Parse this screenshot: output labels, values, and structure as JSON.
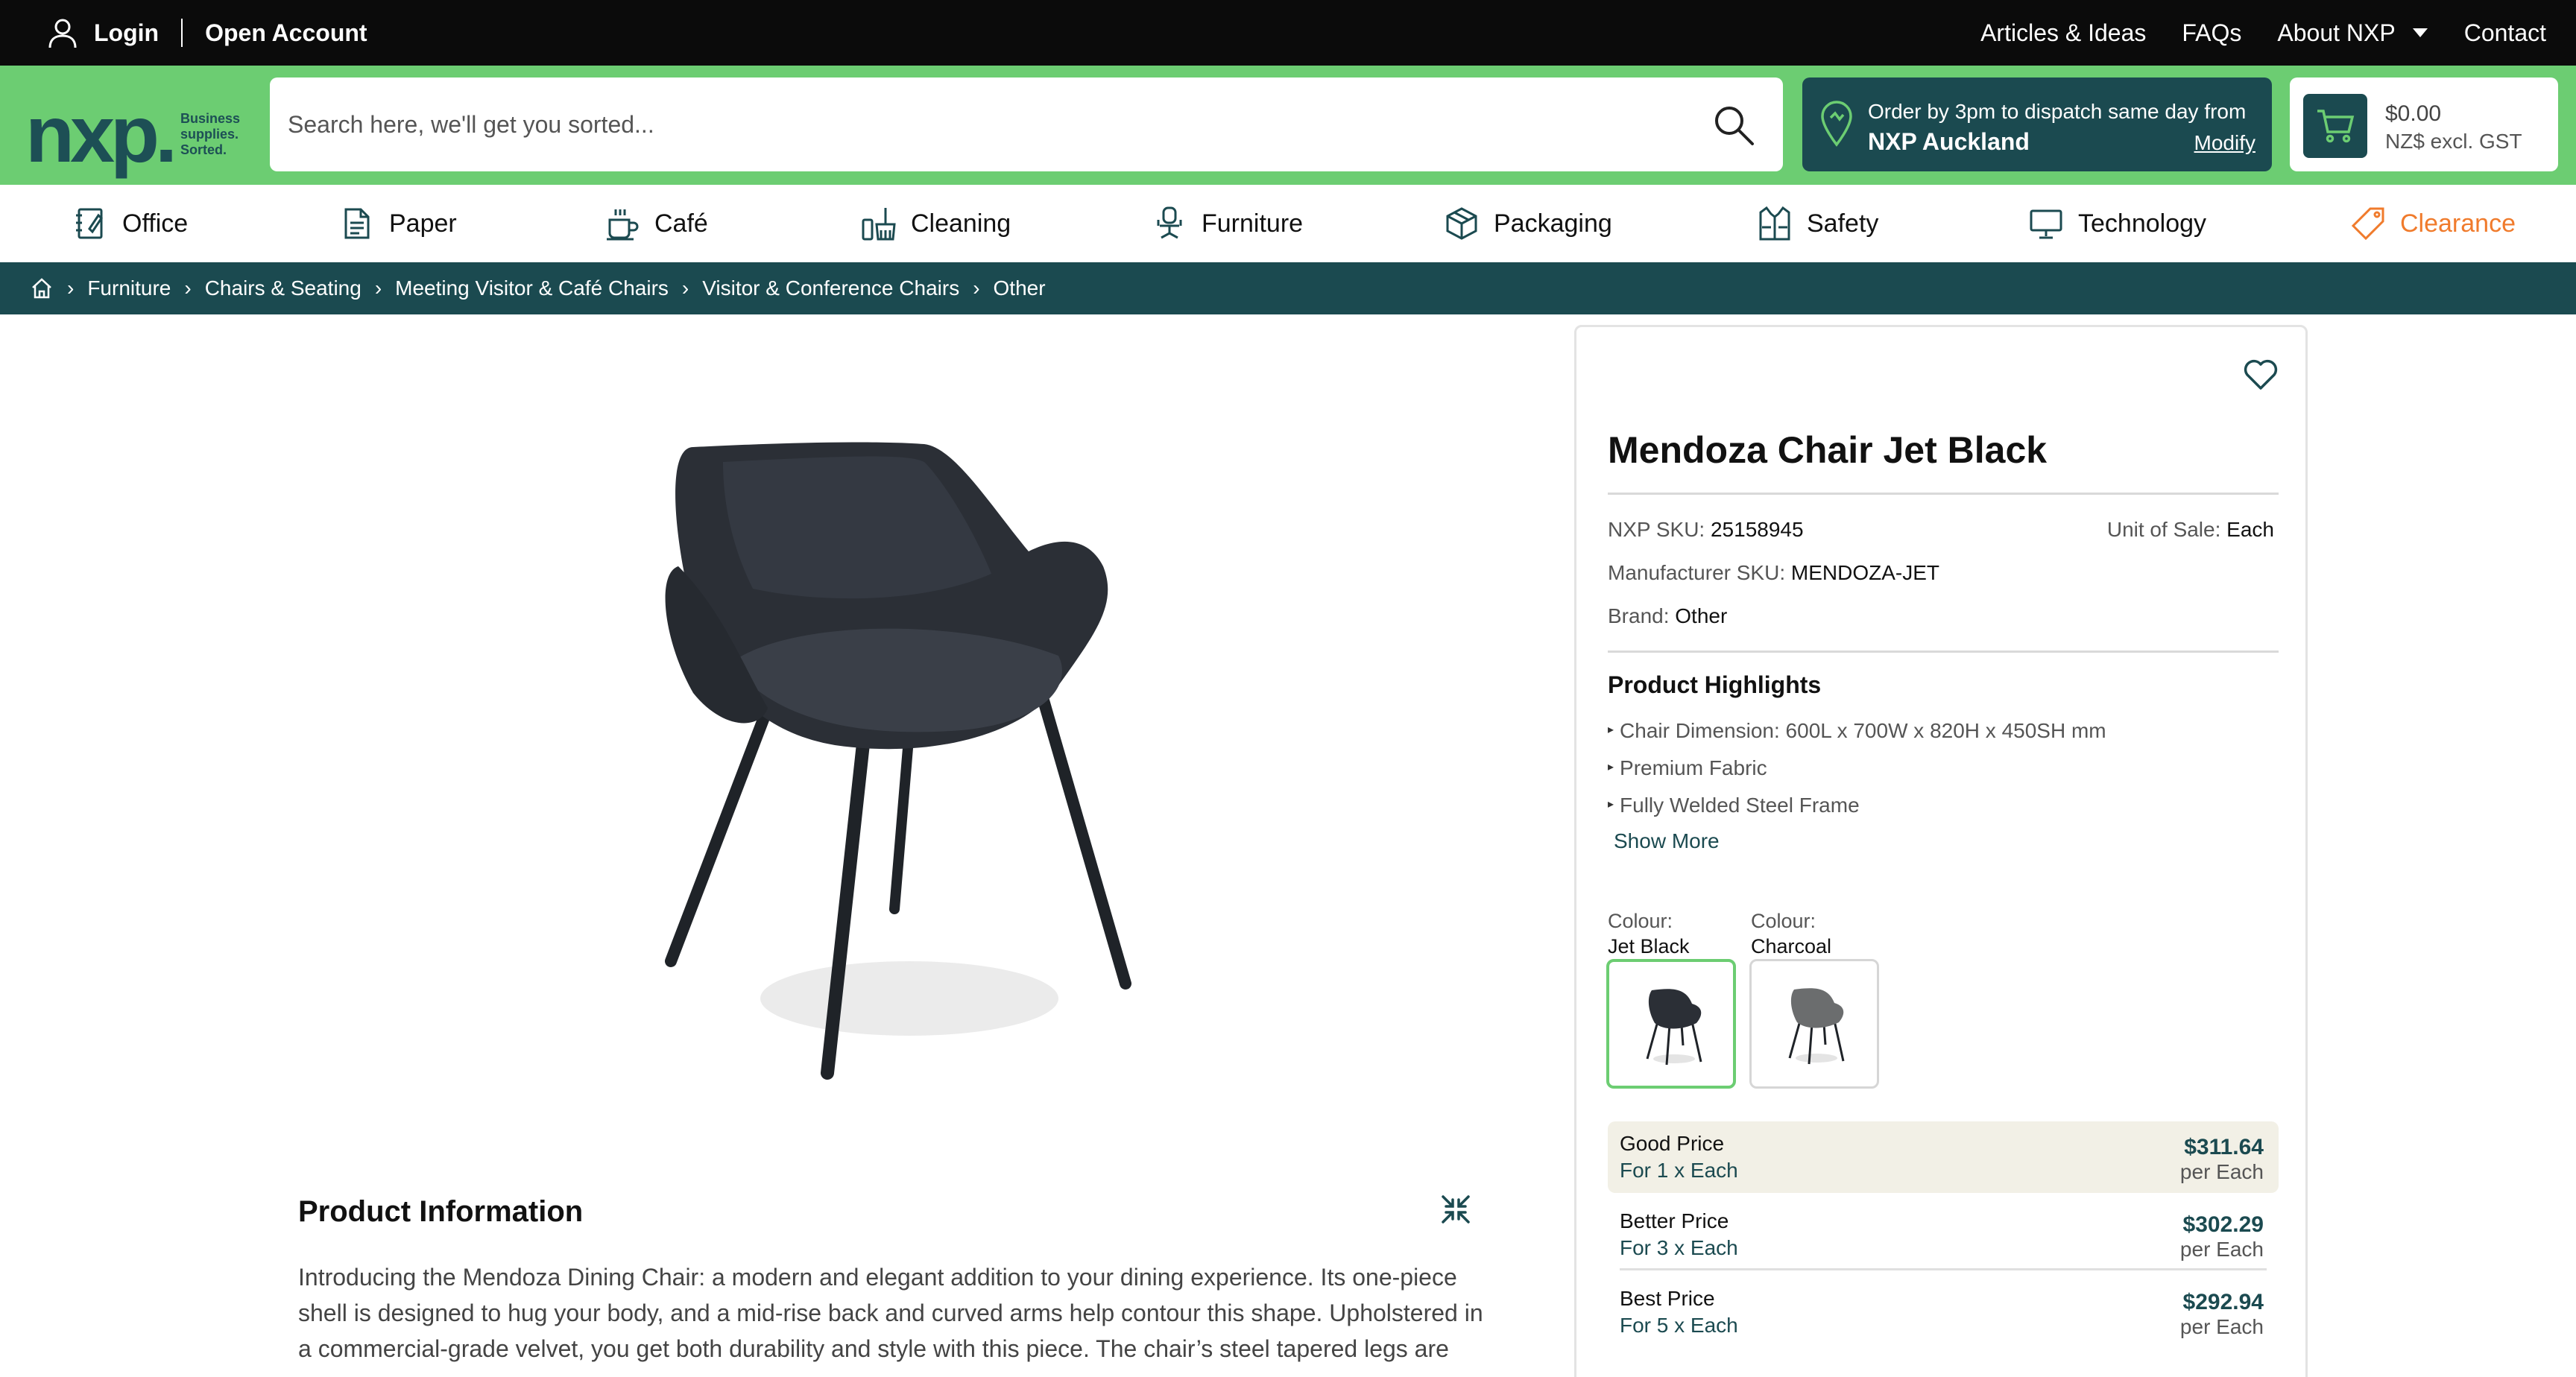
{
  "topbar": {
    "login": "Login",
    "open_account": "Open Account",
    "links": [
      "Articles & Ideas",
      "FAQs",
      "About NXP",
      "Contact"
    ]
  },
  "header": {
    "logo_text": "nxp.",
    "logo_tag": [
      "Business",
      "supplies.",
      "Sorted."
    ],
    "search_placeholder": "Search here, we'll get you sorted...",
    "dispatch_line1": "Order by 3pm to dispatch same day from",
    "dispatch_location": "NXP Auckland",
    "dispatch_modify": "Modify",
    "cart_amount": "$0.00",
    "cart_currency": "NZ$ excl. GST"
  },
  "categories": [
    {
      "label": "Office",
      "icon": "notebook-icon"
    },
    {
      "label": "Paper",
      "icon": "document-icon"
    },
    {
      "label": "Café",
      "icon": "coffee-cup-icon"
    },
    {
      "label": "Cleaning",
      "icon": "broom-icon"
    },
    {
      "label": "Furniture",
      "icon": "office-chair-icon"
    },
    {
      "label": "Packaging",
      "icon": "box-icon"
    },
    {
      "label": "Safety",
      "icon": "safety-vest-icon"
    },
    {
      "label": "Technology",
      "icon": "monitor-icon"
    },
    {
      "label": "Clearance",
      "icon": "price-tag-icon"
    }
  ],
  "breadcrumb": [
    "Furniture",
    "Chairs & Seating",
    "Meeting Visitor & Café Chairs",
    "Visitor & Conference Chairs",
    "Other"
  ],
  "product": {
    "title": "Mendoza Chair Jet Black",
    "nxp_sku_label": "NXP SKU:",
    "nxp_sku": "25158945",
    "unit_label": "Unit of Sale:",
    "unit": "Each",
    "mfr_sku_label": "Manufacturer SKU:",
    "mfr_sku": "MENDOZA-JET",
    "brand_label": "Brand:",
    "brand": "Other",
    "highlights_title": "Product Highlights",
    "highlights": [
      "Chair Dimension: 600L x 700W x 820H x 450SH mm",
      "Premium Fabric",
      "Fully Welded Steel Frame"
    ],
    "show_more": "Show More",
    "colour_label": "Colour:",
    "colours": [
      {
        "name": "Jet Black",
        "hex": "#2b2f36",
        "selected": true
      },
      {
        "name": "Charcoal",
        "hex": "#6b6d6e",
        "selected": false
      }
    ],
    "price_tiers": [
      {
        "name": "Good Price",
        "qty": "For 1 x Each",
        "price": "$311.64",
        "per": "per Each"
      },
      {
        "name": "Better Price",
        "qty": "For 3 x Each",
        "price": "$302.29",
        "per": "per Each"
      },
      {
        "name": "Best Price",
        "qty": "For 5 x Each",
        "price": "$292.94",
        "per": "per Each"
      }
    ]
  },
  "info": {
    "title": "Product Information",
    "text_lines": [
      "Introducing the Mendoza Dining Chair: a modern and elegant addition to your dining experience. Its one-piece",
      "shell is designed to hug your body, and a mid-rise back and curved arms help contour this shape. Upholstered in",
      "a commercial-grade velvet, you get both durability and style with this piece. The chair’s steel tapered legs are"
    ]
  },
  "colors": {
    "topbar": "#0b0b0b",
    "brand_green": "#6ccd72",
    "brand_teal": "#1b4a50",
    "clearance": "#f07b2c"
  }
}
